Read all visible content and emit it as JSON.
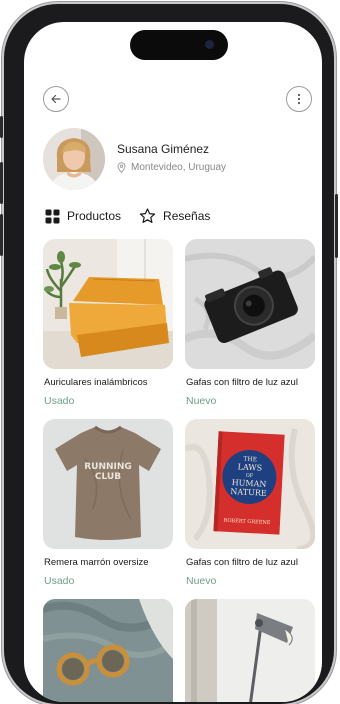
{
  "header": {
    "back_icon": "arrow-left-icon",
    "menu_icon": "more-vertical-icon"
  },
  "profile": {
    "name": "Susana Giménez",
    "location": "Montevideo, Uruguay",
    "location_icon": "map-pin-icon"
  },
  "tabs": [
    {
      "label": "Productos",
      "icon": "grid-icon"
    },
    {
      "label": "Reseñas",
      "icon": "star-icon"
    }
  ],
  "products": [
    {
      "title": "Auriculares inalámbricos",
      "condition": "Usado",
      "image": "orange-sofa"
    },
    {
      "title": "Gafas con filtro de luz azul",
      "condition": "Nuevo",
      "image": "black-camera"
    },
    {
      "title": "Remera marrón oversize",
      "condition": "Usado",
      "image": "brown-tshirt",
      "print": [
        "RUNNING",
        "CLUB"
      ]
    },
    {
      "title": "Gafas con filtro de luz azul",
      "condition": "Nuevo",
      "image": "book",
      "book": [
        "THE",
        "LAWS",
        "OF",
        "HUMAN",
        "NATURE",
        "ROBERT GREENE"
      ]
    },
    {
      "title": "",
      "condition": "",
      "image": "sunglasses-sweater"
    },
    {
      "title": "",
      "condition": "",
      "image": "desk-lamp"
    }
  ],
  "colors": {
    "accent": "#6f9e86",
    "text": "#1a1a1a",
    "muted": "#888888"
  }
}
